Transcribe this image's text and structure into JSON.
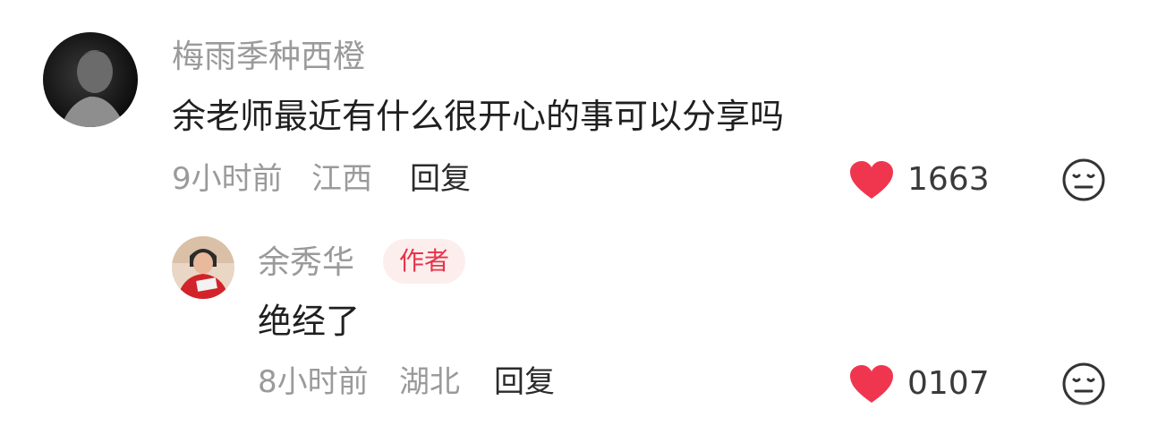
{
  "comments": [
    {
      "username": "梅雨季种西橙",
      "text": "余老师最近有什么很开心的事可以分享吗",
      "time": "9小时前",
      "location": "江西",
      "reply_label": "回复",
      "likes": "1663",
      "avatar_icon": "avatar-photo-grayscale-person",
      "like_icon": "heart-icon",
      "dislike_icon": "meh-face-icon",
      "like_color": "#f0364f"
    },
    {
      "username": "余秀华",
      "badge": "作者",
      "text": "绝经了",
      "time": "8小时前",
      "location": "湖北",
      "reply_label": "回复",
      "likes": "0107",
      "avatar_icon": "avatar-photo-red-clothes-person",
      "like_icon": "heart-icon",
      "dislike_icon": "meh-face-icon",
      "like_color": "#f0364f"
    }
  ],
  "colors": {
    "username": "#9a9a9a",
    "text": "#1f1f1f",
    "meta": "#9a9a9a",
    "badge_bg": "#fdeeee",
    "badge_text": "#e9334a",
    "heart": "#f0364f"
  }
}
